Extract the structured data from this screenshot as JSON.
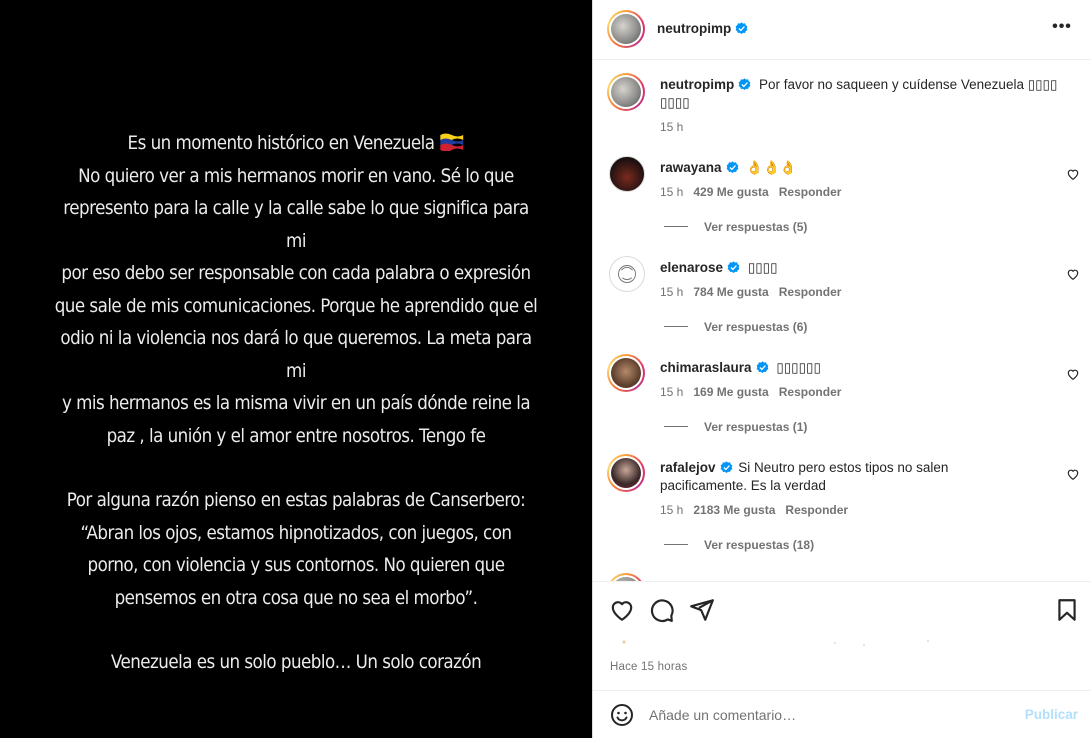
{
  "post": {
    "lines": [
      "Es un momento histórico en Venezuela",
      "No quiero ver a mis hermanos morir en vano. Sé lo que",
      "represento para la calle y la calle sabe lo que significa para mi",
      "por eso debo ser responsable con cada palabra o expresión",
      "que sale de mis comunicaciones. Porque he aprendido que el",
      "odio ni la violencia nos dará lo que queremos. La meta para mi",
      "y mis hermanos es la misma vivir en un país dónde reine la",
      "paz , la unión y el amor entre nosotros. Tengo fe"
    ],
    "lines2": [
      "Por alguna razón pienso en estas palabras de Canserbero:",
      "“Abran los ojos, estamos hipnotizados, con juegos, con",
      "porno, con violencia y sus contornos. No quieren que",
      "pensemos en otra cosa que no sea el morbo”."
    ],
    "lines3": [
      "Venezuela es un solo pueblo… Un solo corazón"
    ]
  },
  "header": {
    "username": "neutropimp",
    "more": "•••"
  },
  "caption": {
    "username": "neutropimp",
    "text": "Por favor no saqueen y cuídense Venezuela ▯▯▯▯ ▯▯▯▯",
    "time": "15 h"
  },
  "comments": [
    {
      "username": "rawayana",
      "text": "👌👌👌",
      "time": "15 h",
      "likes": "429 Me gusta",
      "reply": "Responder",
      "replies": "Ver respuestas (5)"
    },
    {
      "username": "elenarose",
      "text": "▯▯▯▯",
      "time": "15 h",
      "likes": "784 Me gusta",
      "reply": "Responder",
      "replies": "Ver respuestas (6)"
    },
    {
      "username": "chimaraslaura",
      "text": "▯▯▯▯▯▯",
      "time": "15 h",
      "likes": "169 Me gusta",
      "reply": "Responder",
      "replies": "Ver respuestas (1)"
    },
    {
      "username": "rafalejov",
      "text": "Si Neutro pero estos tipos no salen pacificamente. Es la verdad",
      "time": "15 h",
      "likes": "2183 Me gusta",
      "reply": "Responder",
      "replies": "Ver respuestas (18)"
    }
  ],
  "footer": {
    "time_ago": "Hace 15 horas",
    "placeholder": "Añade un comentario…",
    "post_label": "Publicar"
  },
  "colors": {
    "verified": "#0095f6",
    "publish_disabled": "#b2dffc"
  }
}
